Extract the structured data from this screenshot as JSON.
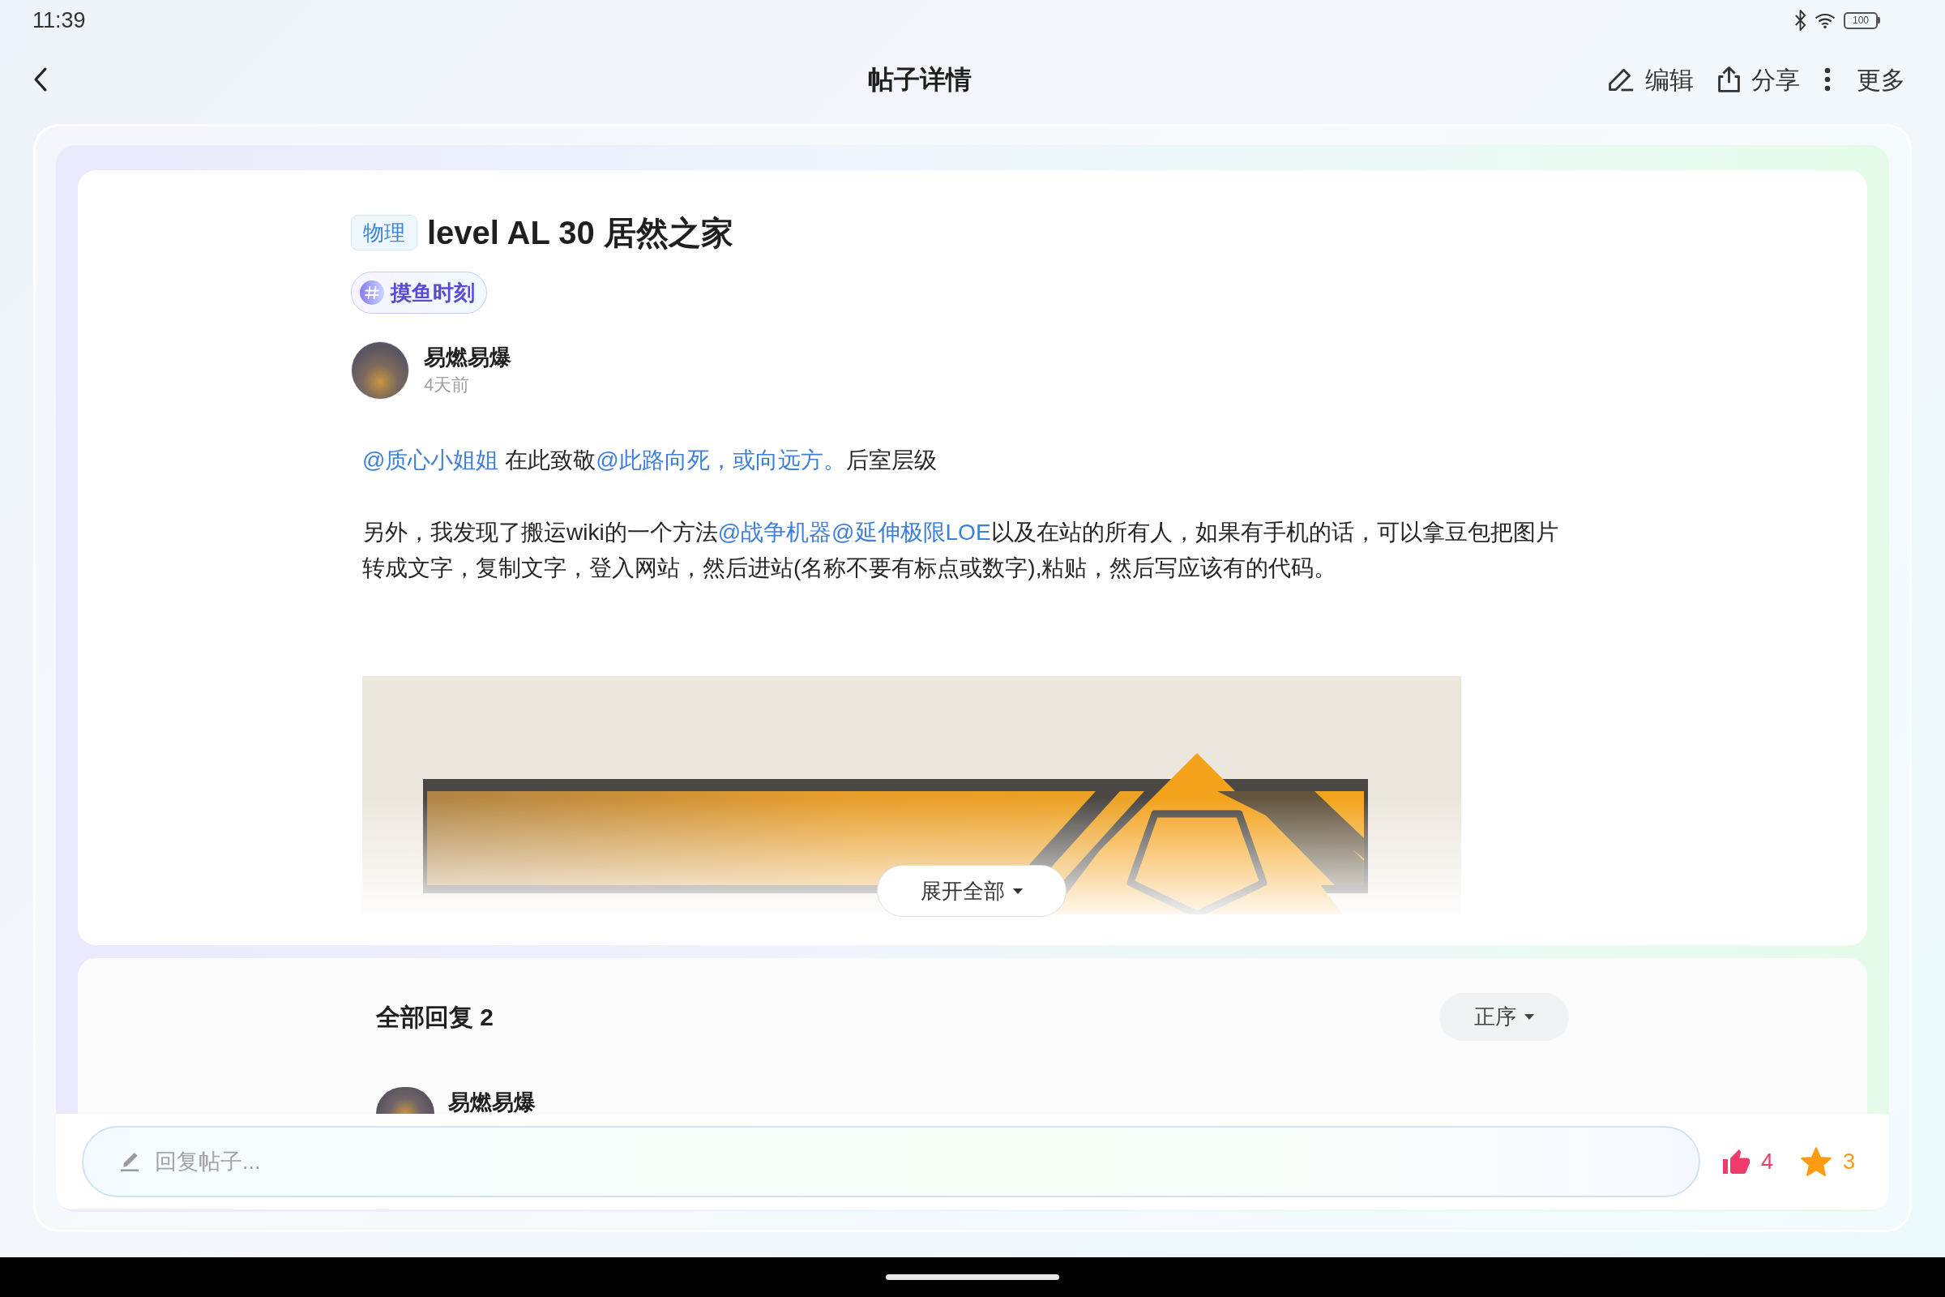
{
  "status_bar": {
    "time": "11:39",
    "battery": "100"
  },
  "header": {
    "title": "帖子详情",
    "actions": [
      {
        "kind": "edit",
        "label": "编辑"
      },
      {
        "kind": "share",
        "label": "分享"
      },
      {
        "kind": "more",
        "label": "更多"
      }
    ]
  },
  "post": {
    "category": "物理",
    "title": "level AL 30 居然之家",
    "topic": "摸鱼时刻",
    "author": {
      "name": "易燃易爆",
      "time": "4天前"
    },
    "paragraphs": [
      [
        {
          "kind": "mention",
          "text": "@质心小姐姐"
        },
        {
          "kind": "text",
          "text": " 在此致敬"
        },
        {
          "kind": "mention",
          "text": "@此路向死，或向远方。"
        },
        {
          "kind": "text",
          "text": "后室层级"
        }
      ],
      [
        {
          "kind": "text",
          "text": "另外，我发现了搬运wiki的一个方法"
        },
        {
          "kind": "mention",
          "text": "@战争机器"
        },
        {
          "kind": "mention",
          "text": "@延伸极限LOE"
        },
        {
          "kind": "text",
          "text": "以及在站的所有人，如果有手机的话，可以拿豆包把图片转成文字，复制文字，登入网站，然后进站(名称不要有标点或数字),粘贴，然后写应该有的代码。"
        }
      ]
    ],
    "expand_button": "展开全部"
  },
  "replies": {
    "heading": "全部回复 2",
    "sort": "正序",
    "items": [
      {
        "author": "易燃易爆"
      }
    ]
  },
  "reply_bar": {
    "placeholder": "回复帖子...",
    "likes": "4",
    "favorites": "3"
  }
}
